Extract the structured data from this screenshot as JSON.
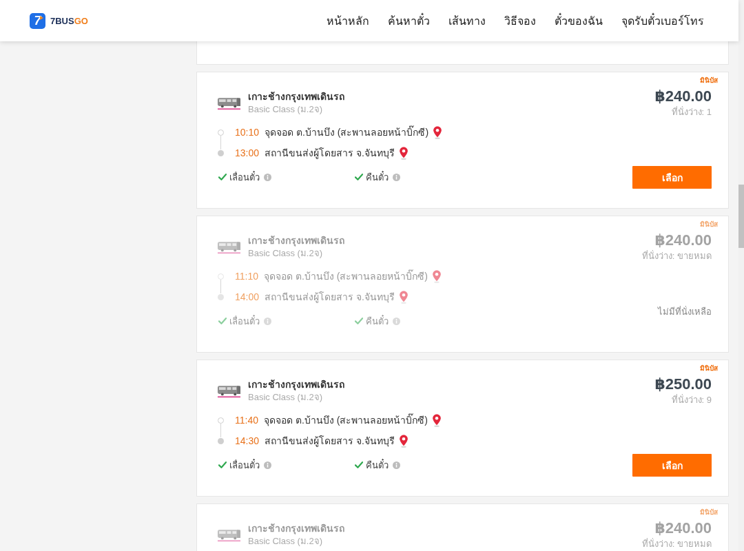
{
  "header": {
    "logo": {
      "mark": "7",
      "name": "7BUS",
      "name_accent": "GO"
    },
    "nav": [
      {
        "label": "หน้าหลัก"
      },
      {
        "label": "ค้นหาตั๋ว"
      },
      {
        "label": "เส้นทาง"
      },
      {
        "label": "วิธีจอง"
      },
      {
        "label": "ตั๋วของฉัน"
      },
      {
        "label": "จุดรับตั๋วเบอร์โทร"
      }
    ]
  },
  "results": {
    "partial_card_above": true,
    "trips": [
      {
        "vehicle_type": "มินิบัส",
        "operator": "เกาะช้างกรุงเทพเดินรถ",
        "bus_class": "Basic Class (ม.2จ)",
        "price": "฿240.00",
        "seats": "ที่นั่งว่าง: 1",
        "disabled": false,
        "stops": [
          {
            "kind": "departure",
            "time": "10:10",
            "place": "จุดจอด ต.บ้านบึง (สะพานลอยหน้าบิ๊กซี)"
          },
          {
            "kind": "arrival",
            "time": "13:00",
            "place": "สถานีขนส่งผู้โดยสาร จ.จันทบุรี"
          }
        ],
        "features": [
          {
            "label": "เลื่อนตั๋ว",
            "available": true
          },
          {
            "label": "คืนตั๋ว",
            "available": true
          }
        ],
        "action": {
          "kind": "button",
          "label": "เลือก"
        }
      },
      {
        "vehicle_type": "มินิบัส",
        "operator": "เกาะช้างกรุงเทพเดินรถ",
        "bus_class": "Basic Class (ม.2จ)",
        "price": "฿240.00",
        "seats": "ที่นั่งว่าง: ขายหมด",
        "disabled": true,
        "stops": [
          {
            "kind": "departure",
            "time": "11:10",
            "place": "จุดจอด ต.บ้านบึง (สะพานลอยหน้าบิ๊กซี)"
          },
          {
            "kind": "arrival",
            "time": "14:00",
            "place": "สถานีขนส่งผู้โดยสาร จ.จันทบุรี"
          }
        ],
        "features": [
          {
            "label": "เลื่อนตั๋ว",
            "available": true
          },
          {
            "label": "คืนตั๋ว",
            "available": true
          }
        ],
        "action": {
          "kind": "note",
          "label": "ไม่มีที่นั่งเหลือ"
        }
      },
      {
        "vehicle_type": "มินิบัส",
        "operator": "เกาะช้างกรุงเทพเดินรถ",
        "bus_class": "Basic Class (ม.2จ)",
        "price": "฿250.00",
        "seats": "ที่นั่งว่าง: 9",
        "disabled": false,
        "stops": [
          {
            "kind": "departure",
            "time": "11:40",
            "place": "จุดจอด ต.บ้านบึง (สะพานลอยหน้าบิ๊กซี)"
          },
          {
            "kind": "arrival",
            "time": "14:30",
            "place": "สถานีขนส่งผู้โดยสาร จ.จันทบุรี"
          }
        ],
        "features": [
          {
            "label": "เลื่อนตั๋ว",
            "available": true
          },
          {
            "label": "คืนตั๋ว",
            "available": true
          }
        ],
        "action": {
          "kind": "button",
          "label": "เลือก"
        }
      },
      {
        "vehicle_type": "มินิบัส",
        "operator": "เกาะช้างกรุงเทพเดินรถ",
        "bus_class": "Basic Class (ม.2จ)",
        "price": "฿240.00",
        "seats": "ที่นั่งว่าง: ขายหมด",
        "disabled": true
      }
    ]
  }
}
